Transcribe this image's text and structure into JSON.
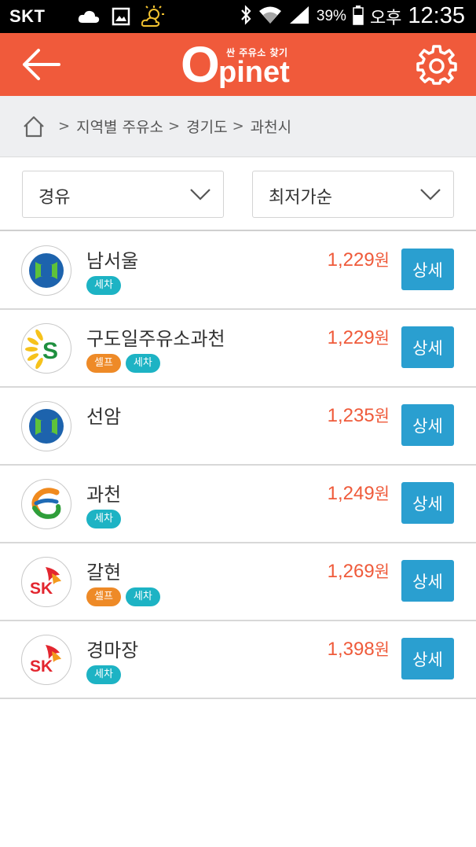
{
  "status_bar": {
    "carrier": "SKT",
    "battery": "39%",
    "ampm": "오후",
    "time": "12:35",
    "icons": [
      "cloud-icon",
      "gallery-icon",
      "weather-sun-cloud-icon",
      "bluetooth-icon",
      "wifi-icon",
      "signal-icon",
      "battery-icon"
    ]
  },
  "header": {
    "logo_sub": "싼 주유소 찾기",
    "logo_o": "O",
    "logo_word": "pinet",
    "color": "#f05a3b",
    "icons": [
      "back-arrow-icon",
      "settings-gear-icon"
    ]
  },
  "breadcrumb": {
    "items": [
      "지역별 주유소",
      "경기도",
      "과천시"
    ],
    "icons": [
      "home-icon",
      "chevron-right-icon"
    ]
  },
  "filters": {
    "fuel": "경유",
    "sort": "최저가순"
  },
  "stations": [
    {
      "name": "남서울",
      "brand": "hyundai-oilbank-logo",
      "price": "1,229",
      "unit": "원",
      "tags": [
        "세차"
      ],
      "detail": "상세"
    },
    {
      "name": "구도일주유소과천",
      "brand": "s-oil-logo",
      "price": "1,229",
      "unit": "원",
      "tags": [
        "셀프",
        "세차"
      ],
      "detail": "상세"
    },
    {
      "name": "선암",
      "brand": "hyundai-oilbank-logo",
      "price": "1,235",
      "unit": "원",
      "tags": [],
      "detail": "상세"
    },
    {
      "name": "과천",
      "brand": "gs-caltex-logo",
      "price": "1,249",
      "unit": "원",
      "tags": [
        "세차"
      ],
      "detail": "상세"
    },
    {
      "name": "갈현",
      "brand": "sk-energy-logo",
      "price": "1,269",
      "unit": "원",
      "tags": [
        "셀프",
        "세차"
      ],
      "detail": "상세"
    },
    {
      "name": "경마장",
      "brand": "sk-energy-logo",
      "price": "1,398",
      "unit": "원",
      "tags": [
        "세차"
      ],
      "detail": "상세"
    }
  ],
  "colors": {
    "price": "#ef5a3a",
    "detail_button": "#2a9fd0",
    "tag_self": "#ee8a27",
    "tag_wash": "#1db3c4"
  }
}
